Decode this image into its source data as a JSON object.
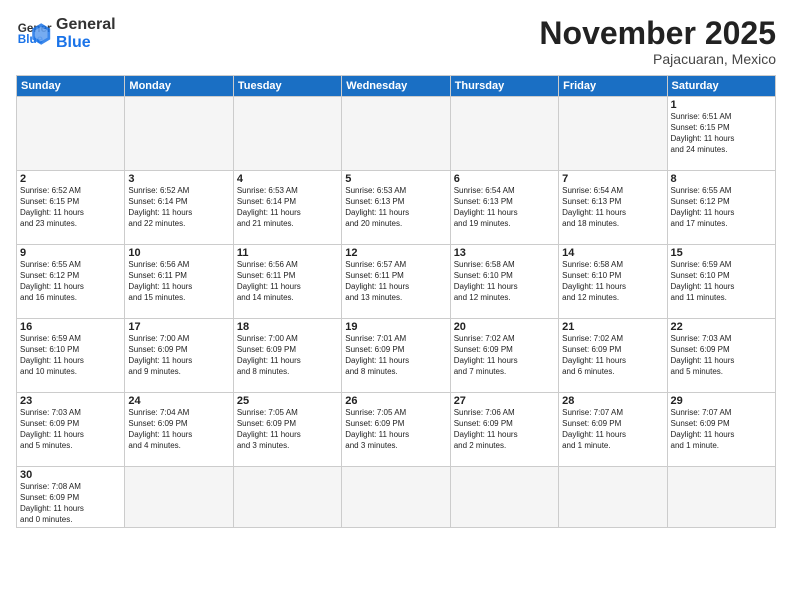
{
  "logo": {
    "general": "General",
    "blue": "Blue"
  },
  "header": {
    "month": "November 2025",
    "location": "Pajacuaran, Mexico"
  },
  "days": [
    "Sunday",
    "Monday",
    "Tuesday",
    "Wednesday",
    "Thursday",
    "Friday",
    "Saturday"
  ],
  "weeks": [
    [
      {
        "day": "",
        "info": ""
      },
      {
        "day": "",
        "info": ""
      },
      {
        "day": "",
        "info": ""
      },
      {
        "day": "",
        "info": ""
      },
      {
        "day": "",
        "info": ""
      },
      {
        "day": "",
        "info": ""
      },
      {
        "day": "1",
        "info": "Sunrise: 6:51 AM\nSunset: 6:15 PM\nDaylight: 11 hours\nand 24 minutes."
      }
    ],
    [
      {
        "day": "2",
        "info": "Sunrise: 6:52 AM\nSunset: 6:15 PM\nDaylight: 11 hours\nand 23 minutes."
      },
      {
        "day": "3",
        "info": "Sunrise: 6:52 AM\nSunset: 6:14 PM\nDaylight: 11 hours\nand 22 minutes."
      },
      {
        "day": "4",
        "info": "Sunrise: 6:53 AM\nSunset: 6:14 PM\nDaylight: 11 hours\nand 21 minutes."
      },
      {
        "day": "5",
        "info": "Sunrise: 6:53 AM\nSunset: 6:13 PM\nDaylight: 11 hours\nand 20 minutes."
      },
      {
        "day": "6",
        "info": "Sunrise: 6:54 AM\nSunset: 6:13 PM\nDaylight: 11 hours\nand 19 minutes."
      },
      {
        "day": "7",
        "info": "Sunrise: 6:54 AM\nSunset: 6:13 PM\nDaylight: 11 hours\nand 18 minutes."
      },
      {
        "day": "8",
        "info": "Sunrise: 6:55 AM\nSunset: 6:12 PM\nDaylight: 11 hours\nand 17 minutes."
      }
    ],
    [
      {
        "day": "9",
        "info": "Sunrise: 6:55 AM\nSunset: 6:12 PM\nDaylight: 11 hours\nand 16 minutes."
      },
      {
        "day": "10",
        "info": "Sunrise: 6:56 AM\nSunset: 6:11 PM\nDaylight: 11 hours\nand 15 minutes."
      },
      {
        "day": "11",
        "info": "Sunrise: 6:56 AM\nSunset: 6:11 PM\nDaylight: 11 hours\nand 14 minutes."
      },
      {
        "day": "12",
        "info": "Sunrise: 6:57 AM\nSunset: 6:11 PM\nDaylight: 11 hours\nand 13 minutes."
      },
      {
        "day": "13",
        "info": "Sunrise: 6:58 AM\nSunset: 6:10 PM\nDaylight: 11 hours\nand 12 minutes."
      },
      {
        "day": "14",
        "info": "Sunrise: 6:58 AM\nSunset: 6:10 PM\nDaylight: 11 hours\nand 12 minutes."
      },
      {
        "day": "15",
        "info": "Sunrise: 6:59 AM\nSunset: 6:10 PM\nDaylight: 11 hours\nand 11 minutes."
      }
    ],
    [
      {
        "day": "16",
        "info": "Sunrise: 6:59 AM\nSunset: 6:10 PM\nDaylight: 11 hours\nand 10 minutes."
      },
      {
        "day": "17",
        "info": "Sunrise: 7:00 AM\nSunset: 6:09 PM\nDaylight: 11 hours\nand 9 minutes."
      },
      {
        "day": "18",
        "info": "Sunrise: 7:00 AM\nSunset: 6:09 PM\nDaylight: 11 hours\nand 8 minutes."
      },
      {
        "day": "19",
        "info": "Sunrise: 7:01 AM\nSunset: 6:09 PM\nDaylight: 11 hours\nand 8 minutes."
      },
      {
        "day": "20",
        "info": "Sunrise: 7:02 AM\nSunset: 6:09 PM\nDaylight: 11 hours\nand 7 minutes."
      },
      {
        "day": "21",
        "info": "Sunrise: 7:02 AM\nSunset: 6:09 PM\nDaylight: 11 hours\nand 6 minutes."
      },
      {
        "day": "22",
        "info": "Sunrise: 7:03 AM\nSunset: 6:09 PM\nDaylight: 11 hours\nand 5 minutes."
      }
    ],
    [
      {
        "day": "23",
        "info": "Sunrise: 7:03 AM\nSunset: 6:09 PM\nDaylight: 11 hours\nand 5 minutes."
      },
      {
        "day": "24",
        "info": "Sunrise: 7:04 AM\nSunset: 6:09 PM\nDaylight: 11 hours\nand 4 minutes."
      },
      {
        "day": "25",
        "info": "Sunrise: 7:05 AM\nSunset: 6:09 PM\nDaylight: 11 hours\nand 3 minutes."
      },
      {
        "day": "26",
        "info": "Sunrise: 7:05 AM\nSunset: 6:09 PM\nDaylight: 11 hours\nand 3 minutes."
      },
      {
        "day": "27",
        "info": "Sunrise: 7:06 AM\nSunset: 6:09 PM\nDaylight: 11 hours\nand 2 minutes."
      },
      {
        "day": "28",
        "info": "Sunrise: 7:07 AM\nSunset: 6:09 PM\nDaylight: 11 hours\nand 1 minute."
      },
      {
        "day": "29",
        "info": "Sunrise: 7:07 AM\nSunset: 6:09 PM\nDaylight: 11 hours\nand 1 minute."
      }
    ],
    [
      {
        "day": "30",
        "info": "Sunrise: 7:08 AM\nSunset: 6:09 PM\nDaylight: 11 hours\nand 0 minutes."
      },
      {
        "day": "",
        "info": ""
      },
      {
        "day": "",
        "info": ""
      },
      {
        "day": "",
        "info": ""
      },
      {
        "day": "",
        "info": ""
      },
      {
        "day": "",
        "info": ""
      },
      {
        "day": "",
        "info": ""
      }
    ]
  ]
}
